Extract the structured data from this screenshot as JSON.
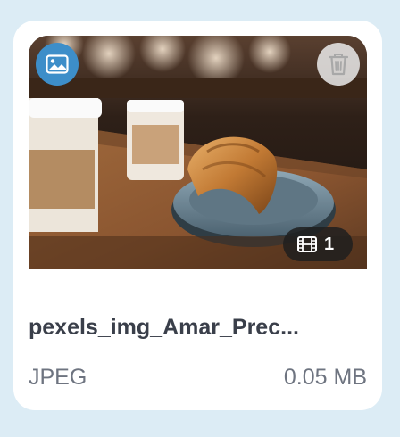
{
  "file": {
    "name": "pexels_img_Amar_Prec...",
    "format": "JPEG",
    "size": "0.05 MB",
    "frame_count": "1"
  },
  "icons": {
    "type_badge": "image-icon",
    "delete": "trash-icon",
    "frames": "film-icon"
  },
  "colors": {
    "background": "#dcecf5",
    "card": "#ffffff",
    "accent": "#3d8ec9",
    "chip": "#1e1e1e",
    "title_text": "#3a3f4a",
    "meta_text": "#6e7480"
  }
}
